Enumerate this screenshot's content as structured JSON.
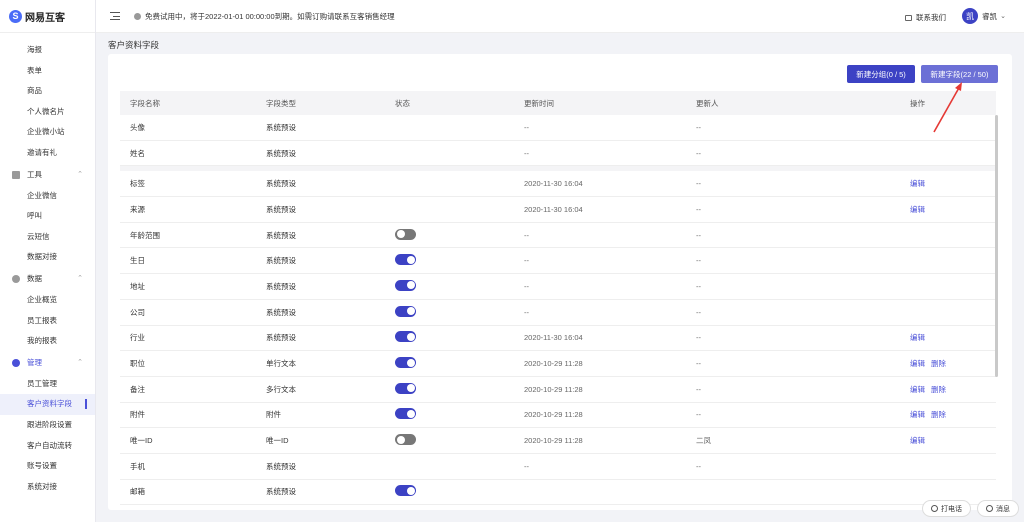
{
  "app": {
    "logo_mark": "S",
    "name": "网易互客"
  },
  "topbar": {
    "notice": "免费试用中，将于2022-01-01 00:00:00到期。如需订购请联系互客销售经理",
    "contact": "联系我们",
    "avatar": "凯",
    "user": "睿凯",
    "user_chevron": "⌄"
  },
  "sidebar": {
    "items_top": [
      "海报",
      "表单",
      "商品",
      "个人微名片",
      "企业微小站",
      "邀请有礼"
    ],
    "groups": [
      {
        "label": "工具",
        "items": [
          "企业微信",
          "呼叫",
          "云短信",
          "数据对接"
        ]
      },
      {
        "label": "数据",
        "items": [
          "企业概览",
          "员工报表",
          "我的报表"
        ]
      },
      {
        "label": "管理",
        "items": [
          "员工管理",
          "客户资料字段",
          "跟进阶段设置",
          "客户自动流转",
          "账号设置",
          "系统对接"
        ]
      }
    ],
    "active": "客户资料字段",
    "chevron": "⌃"
  },
  "page": {
    "title": "客户资料字段"
  },
  "toolbar": {
    "new_group": "新建分组(0 / 5)",
    "new_field": "新建字段(22 / 50)"
  },
  "table": {
    "headers": [
      "字段名称",
      "字段类型",
      "状态",
      "更新时间",
      "更新人",
      "操作"
    ],
    "rows": [
      {
        "name": "头像",
        "type": "系统预设",
        "status": "disabled",
        "time": "--",
        "updater": "--",
        "ops": []
      },
      {
        "name": "姓名",
        "type": "系统预设",
        "status": "disabled",
        "time": "--",
        "updater": "--",
        "ops": []
      },
      {
        "name": "标签",
        "type": "系统预设",
        "status": "disabled",
        "time": "2020-11-30 16:04",
        "updater": "--",
        "ops": [
          "编辑"
        ]
      },
      {
        "name": "来源",
        "type": "系统预设",
        "status": "disabled",
        "time": "2020-11-30 16:04",
        "updater": "--",
        "ops": [
          "编辑"
        ]
      },
      {
        "name": "年龄范围",
        "type": "系统预设",
        "status": "off",
        "time": "--",
        "updater": "--",
        "ops": []
      },
      {
        "name": "生日",
        "type": "系统预设",
        "status": "on",
        "time": "--",
        "updater": "--",
        "ops": []
      },
      {
        "name": "地址",
        "type": "系统预设",
        "status": "on",
        "time": "--",
        "updater": "--",
        "ops": []
      },
      {
        "name": "公司",
        "type": "系统预设",
        "status": "on",
        "time": "--",
        "updater": "--",
        "ops": []
      },
      {
        "name": "行业",
        "type": "系统预设",
        "status": "on",
        "time": "2020-11-30 16:04",
        "updater": "--",
        "ops": [
          "编辑"
        ]
      },
      {
        "name": "职位",
        "type": "单行文本",
        "status": "on",
        "time": "2020-10-29 11:28",
        "updater": "--",
        "ops": [
          "编辑",
          "删除"
        ]
      },
      {
        "name": "备注",
        "type": "多行文本",
        "status": "on",
        "time": "2020-10-29 11:28",
        "updater": "--",
        "ops": [
          "编辑",
          "删除"
        ]
      },
      {
        "name": "附件",
        "type": "附件",
        "status": "on",
        "time": "2020-10-29 11:28",
        "updater": "--",
        "ops": [
          "编辑",
          "删除"
        ]
      },
      {
        "name": "唯一ID",
        "type": "唯一ID",
        "status": "off",
        "time": "2020-10-29 11:28",
        "updater": "二凤",
        "ops": [
          "编辑"
        ]
      },
      {
        "name": "手机",
        "type": "系统预设",
        "status": "disabled",
        "time": "--",
        "updater": "--",
        "ops": []
      },
      {
        "name": "邮箱",
        "type": "系统预设",
        "status": "on",
        "time": "",
        "updater": "",
        "ops": []
      }
    ]
  },
  "float": {
    "call": "打电话",
    "message": "消息"
  },
  "colors": {
    "accent": "#3c42c4",
    "accent_light": "#6c70d6",
    "annotation_arrow": "#e53935"
  }
}
